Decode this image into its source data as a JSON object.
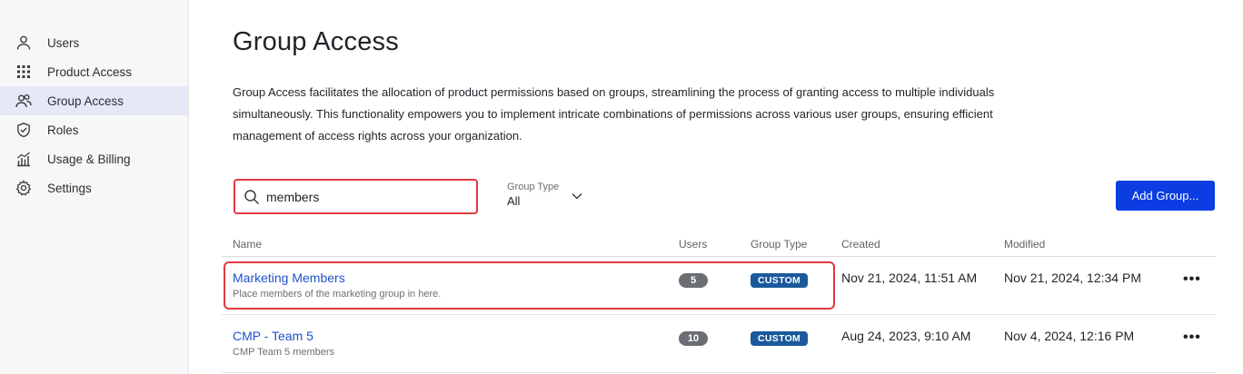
{
  "sidebar": {
    "items": [
      {
        "label": "Users",
        "icon": "user-icon",
        "active": false
      },
      {
        "label": "Product Access",
        "icon": "grid-icon",
        "active": false
      },
      {
        "label": "Group Access",
        "icon": "users-icon",
        "active": true
      },
      {
        "label": "Roles",
        "icon": "shield-icon",
        "active": false
      },
      {
        "label": "Usage & Billing",
        "icon": "bar-chart-icon",
        "active": false
      },
      {
        "label": "Settings",
        "icon": "gear-icon",
        "active": false
      }
    ]
  },
  "page": {
    "title": "Group Access",
    "description": "Group Access facilitates the allocation of product permissions based on groups, streamlining the process of granting access to multiple individuals simultaneously. This functionality empowers you to implement intricate combinations of permissions across various user groups, ensuring efficient management of access rights across your organization."
  },
  "toolbar": {
    "search_value": "members",
    "filter_label": "Group Type",
    "filter_value": "All",
    "add_button": "Add Group..."
  },
  "table": {
    "columns": {
      "name": "Name",
      "users": "Users",
      "type": "Group Type",
      "created": "Created",
      "modified": "Modified"
    },
    "rows": [
      {
        "name": "Marketing Members",
        "description": "Place members of the marketing group in here.",
        "users": "5",
        "type": "CUSTOM",
        "created": "Nov 21, 2024, 11:51 AM",
        "modified": "Nov 21, 2024, 12:34 PM",
        "more": "•••"
      },
      {
        "name": "CMP - Team 5",
        "description": "CMP Team 5 members",
        "users": "10",
        "type": "CUSTOM",
        "created": "Aug 24, 2023, 9:10 AM",
        "modified": "Nov 4, 2024, 12:16 PM",
        "more": "•••"
      }
    ]
  },
  "colors": {
    "accent": "#0b3de3",
    "link": "#1f52cc",
    "highlight": "#e0393e",
    "badge_type": "#1a5a9c",
    "badge_users": "#6b6e72"
  }
}
